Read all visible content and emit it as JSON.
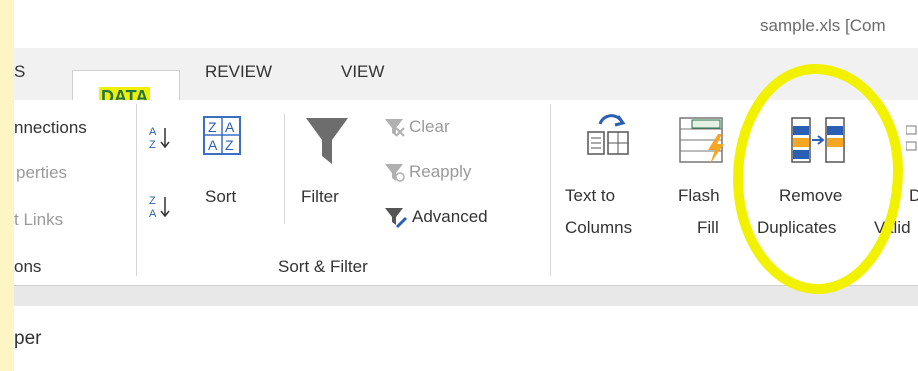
{
  "window": {
    "title": "sample.xls  [Com"
  },
  "tabs": [
    {
      "label": "S"
    },
    {
      "label": "DATA"
    },
    {
      "label": "REVIEW"
    },
    {
      "label": "VIEW"
    }
  ],
  "ribbon": {
    "connections_group": {
      "items": [
        {
          "label": "nnections"
        },
        {
          "label": "perties"
        },
        {
          "label": "t Links"
        }
      ],
      "group_label": "ons"
    },
    "sort_filter_group": {
      "sort_label": "Sort",
      "filter_label": "Filter",
      "clear_label": "Clear",
      "reapply_label": "Reapply",
      "advanced_label": "Advanced",
      "group_label": "Sort & Filter"
    },
    "data_tools_group": {
      "text_to_columns": [
        "Text to",
        "Columns"
      ],
      "flash_fill": [
        "Flash",
        "Fill"
      ],
      "remove_duplicates": [
        "Remove",
        "Duplicates"
      ],
      "data_validation": [
        "D",
        "Valid"
      ]
    }
  },
  "below": {
    "text": "per"
  },
  "colors": {
    "highlight": "#f0f000",
    "excel_green": "#217346"
  }
}
